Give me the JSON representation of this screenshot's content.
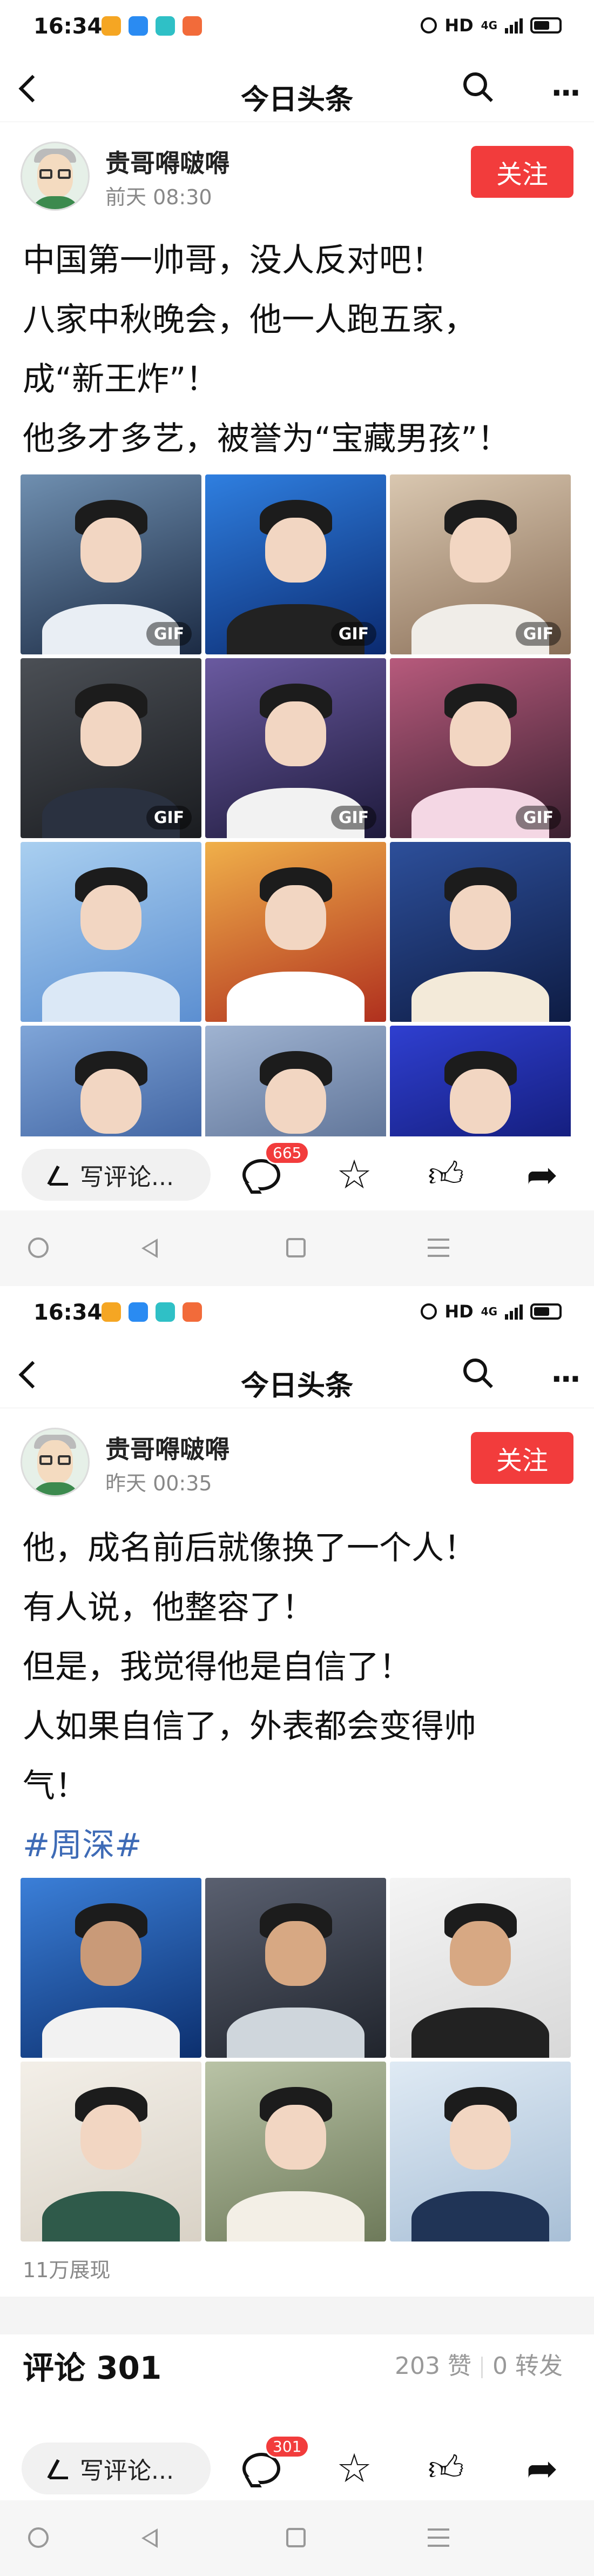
{
  "status_bar": {
    "time": "16:34",
    "network": "HD",
    "signal": "4G",
    "app_icons": [
      {
        "name": "weibo-icon",
        "color": "#f5a623"
      },
      {
        "name": "qq-icon",
        "color": "#2a8bf2"
      },
      {
        "name": "chat-icon",
        "color": "#2fc0c6"
      },
      {
        "name": "taobao-icon",
        "color": "#f26b3a"
      }
    ]
  },
  "nav": {
    "title": "今日头条"
  },
  "accent_color": "#f23c3c",
  "posts": [
    {
      "author": "贵哥嘚啵嘚",
      "time": "前天  08:30",
      "follow_label": "关注",
      "lines": [
        "中国第一帅哥，没人反对吧！",
        "八家中秋晚会，他一人跑五家，",
        "成“新王炸”！",
        "他多才多艺，被誉为“宝藏男孩”！"
      ],
      "gif_label": "GIF"
    },
    {
      "author": "贵哥嘚啵嘚",
      "time": "昨天  00:35",
      "follow_label": "关注",
      "lines": [
        "他，成名前后就像换了一个人！",
        "有人说，他整容了！",
        "但是，我觉得他是自信了！",
        "人如果自信了，外表都会变得帅",
        "气！"
      ],
      "hashtag": "#周深#",
      "views": "11万展现",
      "comments_title": "评论 301",
      "likes": "203 赞",
      "shares": "0 转发"
    }
  ],
  "action_bars": [
    {
      "placeholder": "写评论...",
      "comment_count": "665"
    },
    {
      "placeholder": "写评论...",
      "comment_count": "301"
    }
  ]
}
